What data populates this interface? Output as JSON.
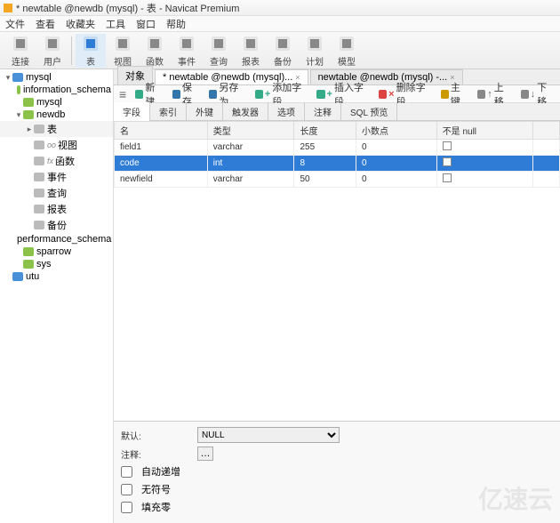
{
  "title": "* newtable @newdb (mysql) - 表 - Navicat Premium",
  "menu": [
    "文件",
    "查看",
    "收藏夹",
    "工具",
    "窗口",
    "帮助"
  ],
  "toolbar": [
    {
      "label": "连接",
      "icon": "plug"
    },
    {
      "label": "用户",
      "icon": "user"
    },
    {
      "sep": true
    },
    {
      "label": "表",
      "icon": "table",
      "active": true
    },
    {
      "label": "视图",
      "icon": "view"
    },
    {
      "label": "函数",
      "icon": "func"
    },
    {
      "label": "事件",
      "icon": "event"
    },
    {
      "label": "查询",
      "icon": "query"
    },
    {
      "label": "报表",
      "icon": "report"
    },
    {
      "label": "备份",
      "icon": "backup"
    },
    {
      "label": "计划",
      "icon": "schedule"
    },
    {
      "label": "模型",
      "icon": "model"
    }
  ],
  "tree": [
    {
      "ind": 0,
      "exp": "▾",
      "icon": "db",
      "label": "mysql"
    },
    {
      "ind": 1,
      "exp": "",
      "icon": "db2",
      "label": "information_schema"
    },
    {
      "ind": 1,
      "exp": "",
      "icon": "db2",
      "label": "mysql"
    },
    {
      "ind": 1,
      "exp": "▾",
      "icon": "db2",
      "label": "newdb",
      "sel": false
    },
    {
      "ind": 2,
      "exp": "▸",
      "icon": "tbl",
      "label": "表",
      "sel": true
    },
    {
      "ind": 2,
      "exp": "",
      "icon": "vw",
      "label": "视图",
      "pre": "oo"
    },
    {
      "ind": 2,
      "exp": "",
      "icon": "fn",
      "label": "函数",
      "pre": "fx"
    },
    {
      "ind": 2,
      "exp": "",
      "icon": "ev",
      "label": "事件"
    },
    {
      "ind": 2,
      "exp": "",
      "icon": "qr",
      "label": "查询"
    },
    {
      "ind": 2,
      "exp": "",
      "icon": "rp",
      "label": "报表"
    },
    {
      "ind": 2,
      "exp": "",
      "icon": "bk",
      "label": "备份"
    },
    {
      "ind": 1,
      "exp": "",
      "icon": "db2",
      "label": "performance_schema"
    },
    {
      "ind": 1,
      "exp": "",
      "icon": "db2",
      "label": "sparrow"
    },
    {
      "ind": 1,
      "exp": "",
      "icon": "db2",
      "label": "sys"
    },
    {
      "ind": 0,
      "exp": "",
      "icon": "db",
      "label": "utu"
    }
  ],
  "objtabs": [
    {
      "label": "对象",
      "active": false,
      "close": false
    },
    {
      "label": "* newtable @newdb (mysql)...",
      "active": true,
      "close": true
    },
    {
      "label": "newtable @newdb (mysql) -...",
      "active": false,
      "close": true
    }
  ],
  "subtoolbar": {
    "menu_icon": "≡",
    "items": [
      {
        "label": "新建",
        "icon": "new",
        "color": "#3a8"
      },
      {
        "label": "保存",
        "icon": "save",
        "color": "#37a"
      },
      {
        "label": "另存为",
        "icon": "saveas",
        "color": "#37a"
      },
      {
        "label": "添加字段",
        "icon": "addcol",
        "color": "#3a8",
        "pre": "+"
      },
      {
        "label": "插入字段",
        "icon": "inscol",
        "color": "#3a8",
        "pre": "+"
      },
      {
        "label": "删除字段",
        "icon": "delcol",
        "color": "#d44",
        "pre": "×"
      },
      {
        "label": "主键",
        "icon": "pkey",
        "color": "#c90"
      },
      {
        "label": "上移",
        "icon": "up",
        "pre": "↑"
      },
      {
        "label": "下移",
        "icon": "down",
        "pre": "↓"
      }
    ]
  },
  "design_tabs": [
    "字段",
    "索引",
    "外键",
    "触发器",
    "选项",
    "注释",
    "SQL 预览"
  ],
  "design_active": 0,
  "columns": [
    "名",
    "类型",
    "长度",
    "小数点",
    "不是 null"
  ],
  "rows": [
    {
      "name": "field1",
      "type": "varchar",
      "len": "255",
      "dec": "0",
      "nn": false,
      "sel": false
    },
    {
      "name": "code",
      "type": "int",
      "len": "8",
      "dec": "0",
      "nn": false,
      "sel": true
    },
    {
      "name": "newfield",
      "type": "varchar",
      "len": "50",
      "dec": "0",
      "nn": false,
      "sel": false
    }
  ],
  "bottom": {
    "default_label": "默认:",
    "default_value": "NULL",
    "comment_label": "注释:",
    "auto_label": "自动递增",
    "unsigned_label": "无符号",
    "zerofill_label": "填充零"
  },
  "watermark": "亿速云"
}
